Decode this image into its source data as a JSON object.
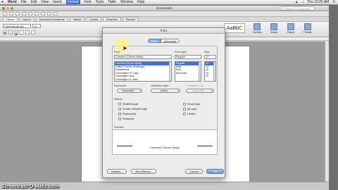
{
  "menubar": {
    "apple": "",
    "app": "Word",
    "items": [
      "File",
      "Edit",
      "View",
      "Insert",
      "Format",
      "Font",
      "Tools",
      "Table",
      "Window",
      "Help"
    ],
    "active": "Format",
    "clock": "Thu 10:25 AM"
  },
  "window": {
    "title": "Document1",
    "search_placeholder": "Search in Document"
  },
  "ribbon": {
    "tabs": [
      "Home",
      "Layout",
      "Document Elements",
      "Tables",
      "Charts",
      "SmartArt",
      "Review"
    ],
    "active_tab": "Home",
    "font_name": "Cambria (Body)",
    "font_size": "12",
    "format_buttons": [
      "B",
      "I",
      "U"
    ],
    "styles_sample": "AaBbC",
    "right_buttons": [
      "Text Box",
      "Shape",
      "Picture",
      "Themes"
    ]
  },
  "dialog": {
    "title": "Font",
    "tabs": [
      "Font",
      "Advanced"
    ],
    "active_tab": "Font",
    "font_label": "Font:",
    "font_value": "Cambria (Theme Body)",
    "font_list": [
      "Cambria (Theme Body)",
      "Calibri (Theme Headings)",
      "Desdemona",
      "Dreamlight HC Caps",
      "Dreamlight Sans",
      "Dreamlight HC Italic"
    ],
    "font_selected_index": 0,
    "style_label": "Font style:",
    "style_value": "Regular",
    "style_list": [
      "Regular",
      "Italic",
      "Bold",
      "Bold Italic"
    ],
    "style_selected_index": 0,
    "size_label": "Size:",
    "size_value": "12",
    "size_list": [
      "12",
      "14",
      "16",
      "18",
      "20"
    ],
    "size_selected_index": 0,
    "font_color_label": "Font color:",
    "font_color_value": "Automatic",
    "underline_style_label": "Underline style:",
    "underline_style_value": "(none)",
    "underline_color_label": "Underline color:",
    "underline_color_value": "Automatic",
    "effects_label": "Effects",
    "effects_left": [
      "Strikethrough",
      "Double strikethrough",
      "Superscript",
      "Subscript"
    ],
    "effects_right": [
      "Small caps",
      "All caps",
      "Hidden"
    ],
    "preview_label": "Preview",
    "preview_text": "Cambria (Theme Body)",
    "buttons": {
      "default": "Default...",
      "text_effects": "Text Effects...",
      "cancel": "Cancel",
      "ok": "OK"
    }
  },
  "watermark": "Screencast-O-Matic.com",
  "colors": {
    "accent": "#3d74d9",
    "highlight": "#fff278"
  }
}
